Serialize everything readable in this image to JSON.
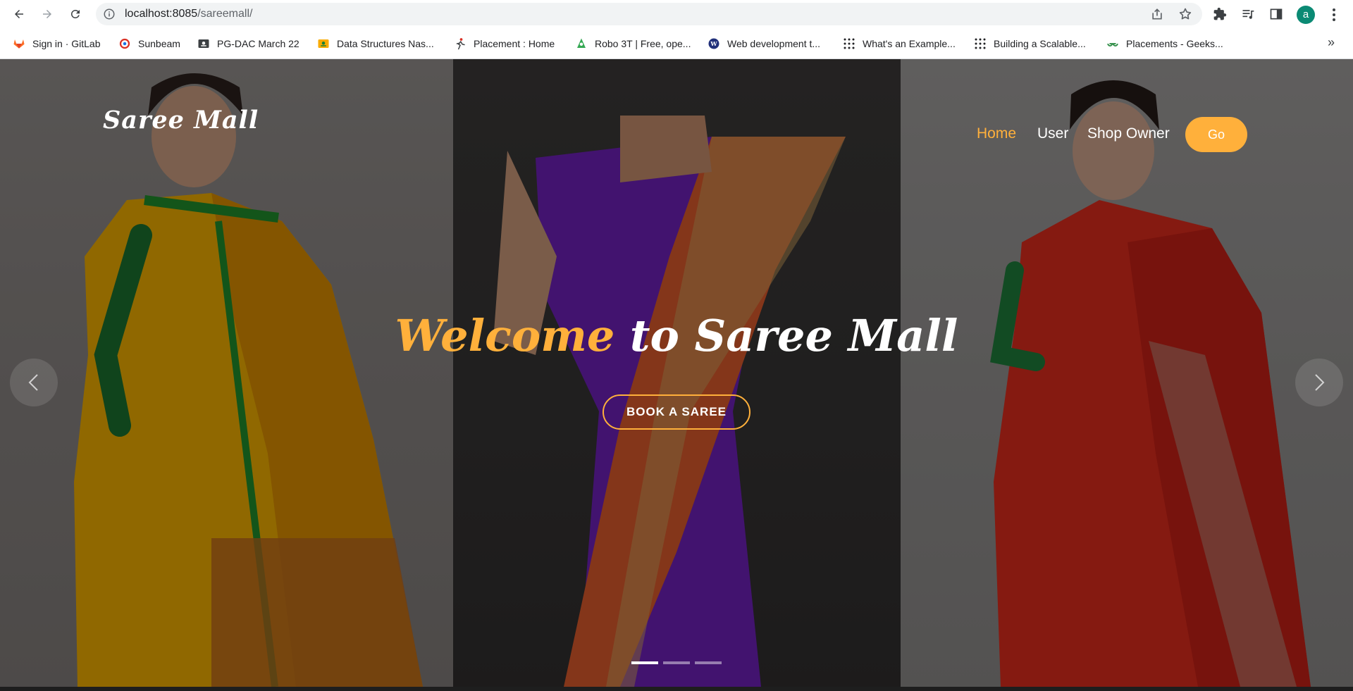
{
  "browser": {
    "url_host": "localhost:8085",
    "url_path": "/sareemall/",
    "profile_initial": "a",
    "bookmarks": [
      {
        "label": "Sign in · GitLab",
        "icon": "gitlab-icon"
      },
      {
        "label": "Sunbeam",
        "icon": "sunbeam-icon"
      },
      {
        "label": "PG-DAC March 22",
        "icon": "classroom-icon"
      },
      {
        "label": "Data Structures Nas...",
        "icon": "classroom-icon"
      },
      {
        "label": "Placement : Home",
        "icon": "placement-icon"
      },
      {
        "label": "Robo 3T | Free, ope...",
        "icon": "robo3t-icon"
      },
      {
        "label": "Web development t...",
        "icon": "wordpress-icon"
      },
      {
        "label": "What's an Example...",
        "icon": "grid-dots-icon"
      },
      {
        "label": "Building a Scalable...",
        "icon": "grid-dots-icon"
      },
      {
        "label": "Placements - Geeks...",
        "icon": "geeksforgeeks-icon"
      }
    ]
  },
  "site": {
    "logo": "Saree Mall",
    "nav": [
      {
        "label": "Home",
        "active": true
      },
      {
        "label": "User",
        "active": false
      },
      {
        "label": "Shop Owner",
        "active": false
      }
    ],
    "go_label": "Go",
    "hero": {
      "title_accent": "Welcome",
      "title_rest": " to Saree Mall",
      "cta_label": "BOOK A SAREE"
    },
    "carousel": {
      "slides": 3,
      "active_index": 0
    }
  },
  "colors": {
    "accent": "#ffb03b",
    "avatar": "#0b8a74"
  }
}
